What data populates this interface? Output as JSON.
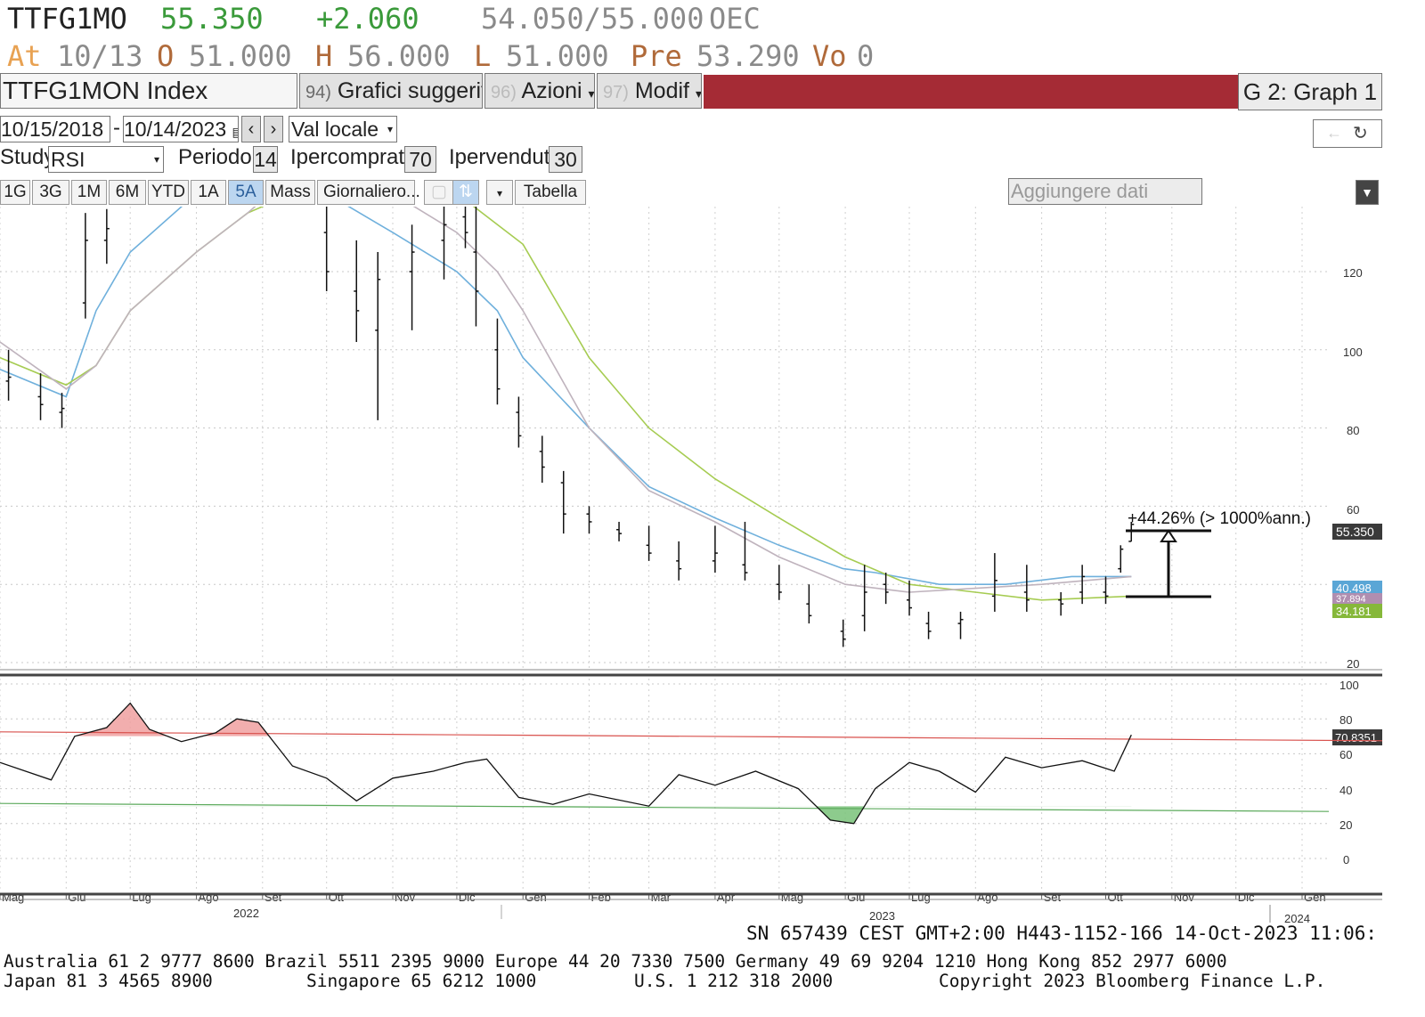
{
  "header": {
    "ticker": "TTFG1MO",
    "last": "55.350",
    "change": "+2.060",
    "bid_ask": "54.050/55.000",
    "exchange": "OEC",
    "at_label": "At",
    "at_date": "10/13",
    "open_label": "O",
    "open": "51.000",
    "high_label": "H",
    "high": "56.000",
    "low_label": "L",
    "low": "51.000",
    "pre_label": "Pre",
    "pre": "53.290",
    "vol_label": "Vo",
    "vol": "0"
  },
  "toolbar": {
    "security": "TTFG1MON Index",
    "suggested_num": "94)",
    "suggested": "Grafici suggeriti",
    "actions_num": "96)",
    "actions": "Azioni",
    "modify_num": "97)",
    "modify": "Modif",
    "graph_label": "G 2: Graph 1",
    "date_from": "10/15/2018",
    "date_sep": "-",
    "date_to": "10/14/2023",
    "currency": "Val locale",
    "study_label": "Study",
    "study": "RSI",
    "period_label": "Periodo",
    "period": "14",
    "overbought_label": "Ipercomprato",
    "overbought": "70",
    "oversold_label": "Ipervenduto",
    "oversold": "30",
    "ranges": [
      "1G",
      "3G",
      "1M",
      "6M",
      "YTD",
      "1A",
      "5A",
      "Mass"
    ],
    "selected_range": "5A",
    "frequency": "Giornaliero...",
    "table": "Tabella",
    "add_data_placeholder": "Aggiungere dati"
  },
  "annotation": {
    "text": "+44.26% (> 1000%ann.)"
  },
  "colors": {
    "ma_blue": "#6fb0dc",
    "ma_green": "#a6cc52",
    "ma_grey": "#bfb3bd",
    "red_line": "#d9534f",
    "green_line": "#5caa5c",
    "rsi_red_fill": "#f0a0a0",
    "rsi_green_fill": "#79c279",
    "header_red": "#a52b35"
  },
  "chart_data": [
    {
      "type": "line",
      "title": "",
      "ylim": [
        20,
        138
      ],
      "y_ticks": [
        120,
        100,
        80,
        60,
        20
      ],
      "x_labels": [
        "Mag",
        "Giu",
        "Lug",
        "Ago",
        "Set",
        "Ott",
        "Nov",
        "Dic",
        "Gen",
        "Feb",
        "Mar",
        "Apr",
        "Mag",
        "Giu",
        "Lug",
        "Ago",
        "Set",
        "Ott",
        "Nov",
        "Dic",
        "Gen"
      ],
      "year_labels": [
        "2022",
        "2023",
        "2024"
      ],
      "series": [
        {
          "name": "",
          "values_x": [
            "2022-05-01",
            "2022-06-01",
            "2022-06-15",
            "2022-07-01",
            "2022-08-01",
            "2022-08-25",
            "2022-09-15",
            "2022-10-01",
            "2022-11-01",
            "2022-12-01",
            "2022-12-20",
            "2023-01-01",
            "2023-02-01",
            "2023-03-01",
            "2023-04-01",
            "2023-05-01",
            "2023-05-31",
            "2023-06-15",
            "2023-07-15",
            "2023-08-15",
            "2023-09-15",
            "2023-10-13"
          ],
          "values": [
            95,
            88,
            110,
            125,
            140,
            150,
            150,
            140,
            130,
            120,
            110,
            98,
            80,
            65,
            57,
            50,
            44,
            43,
            40,
            40,
            42,
            42
          ]
        },
        {
          "name": "",
          "values_x": [
            "2022-05-01",
            "2022-06-01",
            "2022-06-15",
            "2022-07-01",
            "2022-08-01",
            "2022-08-25",
            "2022-09-15",
            "2022-10-01",
            "2022-11-01",
            "2022-12-01",
            "2023-01-01",
            "2023-02-01",
            "2023-03-01",
            "2023-04-01",
            "2023-05-01",
            "2023-06-01",
            "2023-07-01",
            "2023-08-01",
            "2023-09-01",
            "2023-10-13"
          ],
          "values": [
            98,
            91,
            96,
            110,
            125,
            135,
            140,
            145,
            148,
            140,
            127,
            98,
            80,
            67,
            57,
            47,
            40,
            38,
            36,
            37
          ]
        },
        {
          "name": "",
          "values_x": [
            "2022-05-01",
            "2022-06-01",
            "2022-06-15",
            "2022-07-01",
            "2022-08-01",
            "2022-08-25",
            "2022-09-15",
            "2022-10-01",
            "2022-11-01",
            "2022-12-01",
            "2022-12-20",
            "2023-01-01",
            "2023-02-01",
            "2023-03-01",
            "2023-04-01",
            "2023-05-01",
            "2023-06-01",
            "2023-07-01",
            "2023-08-01",
            "2023-09-01",
            "2023-10-13"
          ],
          "values": [
            102,
            90,
            96,
            110,
            125,
            135,
            145,
            150,
            140,
            130,
            120,
            110,
            80,
            64,
            56,
            47,
            40,
            38,
            39,
            40,
            42
          ]
        }
      ],
      "bars": [
        {
          "x": "2022-05-05",
          "o": 92,
          "h": 100,
          "l": 87,
          "c": 93
        },
        {
          "x": "2022-05-20",
          "o": 88,
          "h": 94,
          "l": 82,
          "c": 86
        },
        {
          "x": "2022-05-30",
          "o": 84,
          "h": 89,
          "l": 80,
          "c": 85
        },
        {
          "x": "2022-06-10",
          "o": 112,
          "h": 135,
          "l": 108,
          "c": 128
        },
        {
          "x": "2022-06-20",
          "o": 128,
          "h": 136,
          "l": 122,
          "c": 131
        },
        {
          "x": "2022-10-01",
          "o": 130,
          "h": 140,
          "l": 115,
          "c": 120
        },
        {
          "x": "2022-10-15",
          "o": 115,
          "h": 128,
          "l": 102,
          "c": 110
        },
        {
          "x": "2022-10-25",
          "o": 105,
          "h": 125,
          "l": 82,
          "c": 118
        },
        {
          "x": "2022-11-10",
          "o": 120,
          "h": 132,
          "l": 105,
          "c": 125
        },
        {
          "x": "2022-11-25",
          "o": 128,
          "h": 138,
          "l": 118,
          "c": 132
        },
        {
          "x": "2022-12-05",
          "o": 134,
          "h": 140,
          "l": 126,
          "c": 130
        },
        {
          "x": "2022-12-10",
          "o": 125,
          "h": 137,
          "l": 106,
          "c": 115
        },
        {
          "x": "2022-12-20",
          "o": 100,
          "h": 108,
          "l": 86,
          "c": 90
        },
        {
          "x": "2022-12-30",
          "o": 84,
          "h": 88,
          "l": 75,
          "c": 78
        },
        {
          "x": "2023-01-10",
          "o": 74,
          "h": 78,
          "l": 66,
          "c": 70
        },
        {
          "x": "2023-01-20",
          "o": 66,
          "h": 69,
          "l": 53,
          "c": 58
        },
        {
          "x": "2023-02-01",
          "o": 58,
          "h": 60,
          "l": 53,
          "c": 56
        },
        {
          "x": "2023-02-15",
          "o": 54,
          "h": 56,
          "l": 51,
          "c": 53
        },
        {
          "x": "2023-03-01",
          "o": 50,
          "h": 55,
          "l": 46,
          "c": 48
        },
        {
          "x": "2023-03-15",
          "o": 46,
          "h": 51,
          "l": 41,
          "c": 44
        },
        {
          "x": "2023-04-01",
          "o": 46,
          "h": 55,
          "l": 43,
          "c": 48
        },
        {
          "x": "2023-04-15",
          "o": 45,
          "h": 56,
          "l": 41,
          "c": 43
        },
        {
          "x": "2023-05-01",
          "o": 40,
          "h": 45,
          "l": 36,
          "c": 38
        },
        {
          "x": "2023-05-15",
          "o": 35,
          "h": 40,
          "l": 30,
          "c": 32
        },
        {
          "x": "2023-05-31",
          "o": 28,
          "h": 31,
          "l": 24,
          "c": 26
        },
        {
          "x": "2023-06-10",
          "o": 32,
          "h": 45,
          "l": 28,
          "c": 38
        },
        {
          "x": "2023-06-20",
          "o": 40,
          "h": 43,
          "l": 35,
          "c": 38
        },
        {
          "x": "2023-07-01",
          "o": 36,
          "h": 41,
          "l": 32,
          "c": 34
        },
        {
          "x": "2023-07-10",
          "o": 30,
          "h": 33,
          "l": 26,
          "c": 28
        },
        {
          "x": "2023-07-25",
          "o": 30,
          "h": 33,
          "l": 26,
          "c": 31
        },
        {
          "x": "2023-08-10",
          "o": 37,
          "h": 48,
          "l": 33,
          "c": 41
        },
        {
          "x": "2023-08-25",
          "o": 38,
          "h": 45,
          "l": 33,
          "c": 36
        },
        {
          "x": "2023-09-10",
          "o": 36,
          "h": 38,
          "l": 32,
          "c": 35
        },
        {
          "x": "2023-09-20",
          "o": 38,
          "h": 45,
          "l": 35,
          "c": 42
        },
        {
          "x": "2023-10-01",
          "o": 38,
          "h": 42,
          "l": 35,
          "c": 37
        },
        {
          "x": "2023-10-08",
          "o": 44,
          "h": 50,
          "l": 43,
          "c": 49
        },
        {
          "x": "2023-10-13",
          "o": 51,
          "h": 56,
          "l": 51,
          "c": 55.35
        }
      ],
      "value_labels": [
        "55.350",
        "40.498",
        "37.894",
        "34.181"
      ]
    },
    {
      "type": "line",
      "title": "",
      "ylim": [
        0,
        100
      ],
      "y_ticks": [
        100,
        80,
        60,
        40,
        20,
        0
      ],
      "overbought": 70,
      "oversold": 30,
      "last_value_label": "70.8351",
      "series": [
        {
          "name": "",
          "values_x": [
            "2022-05-01",
            "2022-05-25",
            "2022-06-05",
            "2022-06-20",
            "2022-07-01",
            "2022-07-10",
            "2022-07-25",
            "2022-08-10",
            "2022-08-20",
            "2022-08-30",
            "2022-09-15",
            "2022-10-01",
            "2022-10-15",
            "2022-11-01",
            "2022-11-20",
            "2022-12-05",
            "2022-12-15",
            "2022-12-30",
            "2023-01-15",
            "2023-02-01",
            "2023-03-01",
            "2023-03-15",
            "2023-04-01",
            "2023-04-20",
            "2023-05-10",
            "2023-05-25",
            "2023-06-05",
            "2023-06-15",
            "2023-07-01",
            "2023-07-15",
            "2023-08-01",
            "2023-08-15",
            "2023-09-01",
            "2023-09-20",
            "2023-10-05",
            "2023-10-13"
          ],
          "values": [
            55,
            45,
            70,
            75,
            89,
            74,
            67,
            72,
            80,
            78,
            53,
            46,
            33,
            46,
            50,
            55,
            57,
            35,
            31,
            37,
            30,
            48,
            42,
            50,
            40,
            22,
            20,
            40,
            55,
            50,
            38,
            58,
            52,
            56,
            50,
            70.8
          ]
        }
      ]
    }
  ],
  "axis_text": {
    "xl": [
      "Mag",
      "Giu",
      "Lug",
      "Ago",
      "Set",
      "Ott",
      "Nov",
      "Dic",
      "Gen",
      "Feb",
      "Mar",
      "Apr",
      "Mag",
      "Giu",
      "Lug",
      "Ago",
      "Set",
      "Ott",
      "Nov",
      "Dic",
      "Gen"
    ],
    "y2022": "2022",
    "y2023": "2023",
    "y2024": "2024",
    "pt_120": "120",
    "pt_100": "100",
    "pt_80": "80",
    "pt_60": "60",
    "pt_20": "20",
    "rt_100": "100",
    "rt_80": "80",
    "rt_60": "60",
    "rt_40": "40",
    "rt_20": "20",
    "rt_0": "0",
    "lbl_last": "55.350",
    "lbl_blue": "40.498",
    "lbl_grey": "37.894",
    "lbl_green": "34.181",
    "lbl_rsi": "70.8351"
  },
  "footer": {
    "session": "SN 657439 CEST GMT+2:00 H443-1152-166 14-Oct-2023 11:06:",
    "line1": "Australia 61 2 9777 8600 Brazil 5511 2395 9000 Europe 44 20 7330 7500 Germany 49 69 9204 1210 Hong Kong 852 2977 6000",
    "line2_a": "Japan 81 3 4565 8900",
    "line2_b": "Singapore 65 6212 1000",
    "line2_c": "U.S. 1 212 318 2000",
    "line2_d": "Copyright 2023 Bloomberg Finance L.P."
  }
}
